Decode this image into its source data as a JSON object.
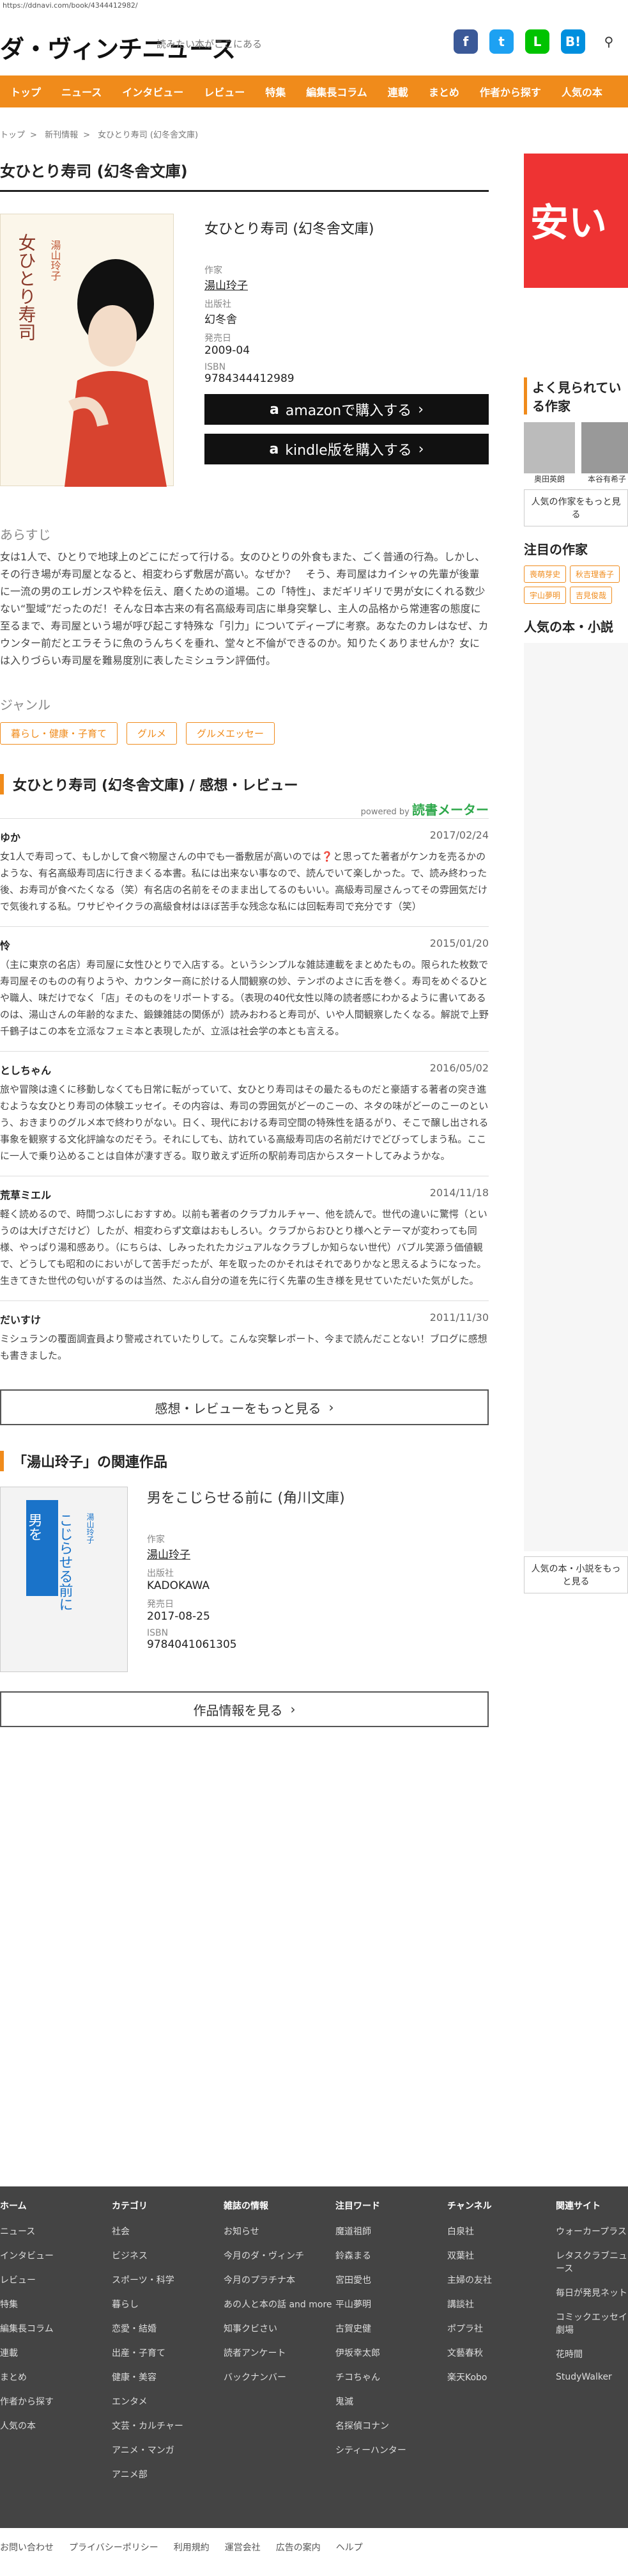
{
  "url": "https://ddnavi.com/book/4344412982/",
  "header": {
    "logo": "ダ・ヴィンチニュース",
    "search_placeholder": "読みたい本がここにある"
  },
  "nav": [
    "トップ",
    "ニュース",
    "インタビュー",
    "レビュー",
    "特集",
    "編集長コラム",
    "連載",
    "まとめ",
    "作者から探す",
    "人気の本"
  ],
  "breadcrumb": [
    "トップ",
    "新刊情報",
    "女ひとり寿司 (幻冬舎文庫)"
  ],
  "page_title": "女ひとり寿司 (幻冬舎文庫)",
  "book": {
    "cover_title": "女ひとり寿司",
    "cover_author": "湯山玲子",
    "title": "女ひとり寿司 (幻冬舎文庫)",
    "author_label": "作家",
    "author": "湯山玲子",
    "publisher_label": "出版社",
    "publisher": "幻冬舎",
    "date_label": "発売日",
    "date": "2009-04",
    "isbn_label": "ISBN",
    "isbn": "9784344412989",
    "amazon_btn": "amazonで購入する",
    "kindle_btn": "kindle版を購入する"
  },
  "synopsis_label": "あらすじ",
  "synopsis": "女は1人で、ひとりで地球上のどこにだって行ける。女のひとりの外食もまた、ごく普通の行為。しかし、その行き場が寿司屋となると、相変わらず敷居が高い。なぜか？　そう、寿司屋はカイシャの先輩が後輩に一流の男のエレガンスや粋を伝え、磨くための道場。この「特性」、まだギリギリで男が女にくれる数少ない“聖域”だったのだ！そんな日本古来の有名高級寿司店に単身突撃し、主人の品格から常連客の態度に至るまで、寿司屋という場が呼び起こす特殊な「引力」についてディープに考察。あなたのカレはなぜ、カウンター前だとエラそうに魚のうんちくを垂れ、堂々と不倫ができるのか。知りたくありませんか？女には入りづらい寿司屋を難易度別に表したミシュラン評価付。",
  "genre_label": "ジャンル",
  "genres": [
    "暮らし・健康・子育て",
    "グルメ",
    "グルメエッセー"
  ],
  "reviews_heading": "女ひとり寿司 (幻冬舎文庫) / 感想・レビュー",
  "powered_by": "powered by",
  "powered_brand": "読書メーター",
  "reviews": [
    {
      "name": "ゆか",
      "date": "2017/02/24",
      "text": "女1人で寿司って、もしかして食べ物屋さんの中でも一番敷居が高いのでは❓と思ってた著者がケンカを売るかのような、有名高級寿司店に行きまくる本書。私には出来ない事なので、読んでいて楽しかった。で、読み終わった後、お寿司が食べたくなる（笑）有名店の名前をそのまま出してるのもいい。高級寿司屋さんってその雰囲気だけで気後れする私。ワサビやイクラの高級食材はほぼ苦手な残念な私には回転寿司で充分です（笑）"
    },
    {
      "name": "怜",
      "date": "2015/01/20",
      "text": "（主に東京の名店）寿司屋に女性ひとりで入店する。というシンプルな雑誌連載をまとめたもの。限られた枚数で寿司屋そのものの有りようや、カウンター商に於ける人間観察の妙、テンポのよさに舌を巻く。寿司をめぐるひとや職人、味だけでなく「店」そのものをリポートする。（表現の40代女性以降の読者感にわかるように書いてあるのは、湯山さんの年齢的なまた、鍛錬雑誌の関係が）読みおわると寿司が、いや人間観察したくなる。解説で上野千鶴子はこの本を立派なフェミ本と表現したが、立派は社会学の本とも言える。"
    },
    {
      "name": "としちゃん",
      "date": "2016/05/02",
      "text": "旅や冒険は遠くに移動しなくても日常に転がっていて、女ひとり寿司はその最たるものだと豪語する著者の突き進むような女ひとり寿司の体験エッセイ。その内容は、寿司の雰囲気がどーのこーの、ネタの味がどーのこーのという、おきまりのグルメ本で終わりがない。日く、現代における寿司空間の特殊性を語るがり、そこで醸し出される事象を観察する文化評論なのだそう。それにしても、訪れている高級寿司店の名前だけでどびってしまう私。ここに一人で乗り込めることは自体が凄すぎる。取り敢えず近所の駅前寿司店からスタートしてみようかな。"
    },
    {
      "name": "荒草ミエル",
      "date": "2014/11/18",
      "text": "軽く読めるので、時間つぶしにおすすめ。以前も著者のクラブカルチャー、他を読んで。世代の違いに驚愕（というのは大げさだけど）したが、相変わらず文章はおもしろい。クラブからおひとり様へとテーマが変わっても同様、やっぱり湯和感あり。（にちらは、しみったれたカジュアルなクラブしか知らない世代）バブル笑源う価値観で、どうしても昭和のにおいがして苦手だったが、年を取ったのかそれはそれでありかなと思えるようになった。生きてきた世代の匂いがするのは当然、たぶん自分の道を先に行く先輩の生き様を見せていただいた気がした。"
    },
    {
      "name": "だいすけ",
      "date": "2011/11/30",
      "text": "ミシュランの覆面調査員より警戒されていたりして。こんな突撃レポート、今まで読んだことない！ブログに感想も書きました。"
    }
  ],
  "more_reviews_btn": "感想・レビューをもっと見る",
  "related_heading": "「湯山玲子」の関連作品",
  "related": {
    "cover_title": "男をこじらせる前に",
    "cover_author": "湯山玲子",
    "title": "男をこじらせる前に (角川文庫)",
    "author_label": "作家",
    "author": "湯山玲子",
    "publisher_label": "出版社",
    "publisher": "KADOKAWA",
    "date_label": "発売日",
    "date": "2017-08-25",
    "isbn_label": "ISBN",
    "isbn": "9784041061305",
    "btn": "作品情報を見る"
  },
  "side": {
    "ad_text": "安い",
    "popular_authors_heading": "よく見られている作家",
    "authors": [
      "奥田英朗",
      "本谷有希子"
    ],
    "popular_authors_btn": "人気の作家をもっと見る",
    "attention_heading": "注目の作家",
    "attention": [
      "喪萌芽史",
      "秋吉理香子",
      "宇山夢明",
      "吉見俊哉"
    ],
    "popular_books_heading": "人気の本・小説",
    "popular_books_btn": "人気の本・小説をもっと見る"
  },
  "footer": {
    "cols": [
      {
        "head": "ホーム",
        "items": [
          "ニュース",
          "インタビュー",
          "レビュー",
          "特集",
          "編集長コラム",
          "連載",
          "まとめ",
          "作者から探す",
          "人気の本"
        ]
      },
      {
        "head": "カテゴリ",
        "items": [
          "社会",
          "ビジネス",
          "スポーツ・科学",
          "暮らし",
          "恋愛・結婚",
          "出産・子育て",
          "健康・美容",
          "エンタメ",
          "文芸・カルチャー",
          "アニメ・マンガ",
          "アニメ部"
        ]
      },
      {
        "head": "雑誌の情報",
        "items": [
          "お知らせ",
          "今月のダ・ヴィンチ",
          "今月のプラチナ本",
          "あの人と本の話 and more",
          "知事クビさい",
          "読者アンケート",
          "バックナンバー"
        ]
      },
      {
        "head": "注目ワード",
        "items": [
          "魔道祖師",
          "鈴森まる",
          "宮田愛也",
          "平山夢明",
          "古賀史健",
          "伊坂幸太郎",
          "チコちゃん",
          "鬼滅",
          "名探偵コナン",
          "シティーハンター"
        ]
      },
      {
        "head": "チャンネル",
        "items": [
          "白泉社",
          "双葉社",
          "主婦の友社",
          "講談社",
          "ポプラ社",
          "文藝春秋",
          "楽天Kobo"
        ]
      },
      {
        "head": "関連サイト",
        "items": [
          "ウォーカープラス",
          "レタスクラブニュース",
          "毎日が発見ネット",
          "コミックエッセイ劇場",
          "花時間",
          "StudyWalker"
        ]
      }
    ],
    "bottom": [
      "お問い合わせ",
      "プライバシーポリシー",
      "利用規約",
      "運営会社",
      "広告の案内",
      "ヘルプ"
    ]
  }
}
